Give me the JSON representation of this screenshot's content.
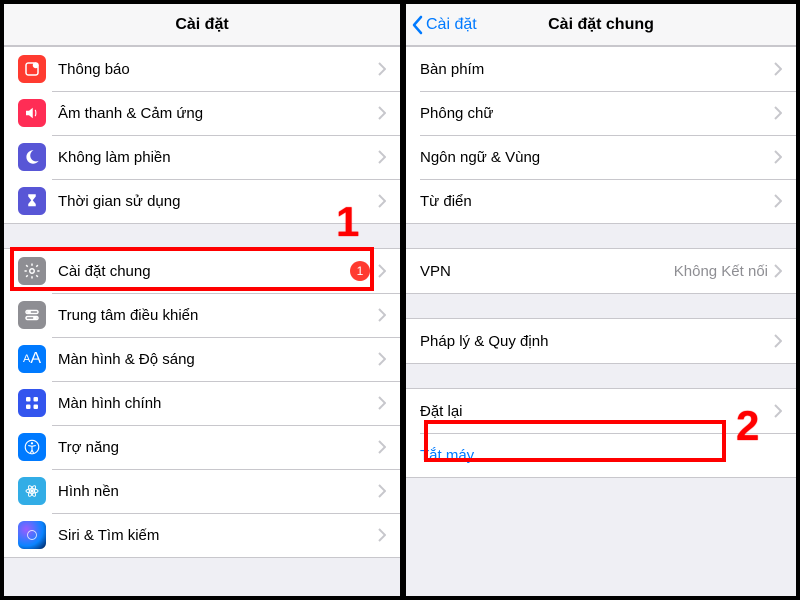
{
  "left": {
    "title": "Cài đặt",
    "rows": [
      {
        "key": "notifications",
        "label": "Thông báo",
        "icon": "notif",
        "bg": "bg-red"
      },
      {
        "key": "sounds",
        "label": "Âm thanh & Cảm ứng",
        "icon": "sound",
        "bg": "bg-pink"
      },
      {
        "key": "dnd",
        "label": "Không làm phiền",
        "icon": "moon",
        "bg": "bg-purple"
      },
      {
        "key": "screentime",
        "label": "Thời gian sử dụng",
        "icon": "hourglass",
        "bg": "bg-indigo"
      }
    ],
    "rows2": [
      {
        "key": "general",
        "label": "Cài đặt chung",
        "icon": "gear",
        "bg": "bg-gray",
        "badge": "1"
      },
      {
        "key": "controlcenter",
        "label": "Trung tâm điều khiển",
        "icon": "switches",
        "bg": "bg-gray"
      },
      {
        "key": "display",
        "label": "Màn hình & Độ sáng",
        "icon": "aa",
        "bg": "bg-blue"
      },
      {
        "key": "homescreen",
        "label": "Màn hình chính",
        "icon": "grid",
        "bg": "bg-home"
      },
      {
        "key": "accessibility",
        "label": "Trợ năng",
        "icon": "person",
        "bg": "bg-blue"
      },
      {
        "key": "wallpaper",
        "label": "Hình nền",
        "icon": "flower",
        "bg": "bg-cyan"
      },
      {
        "key": "siri",
        "label": "Siri & Tìm kiếm",
        "icon": "siri",
        "bg": "bg-siri"
      }
    ]
  },
  "right": {
    "back": "Cài đặt",
    "title": "Cài đặt chung",
    "g1": [
      {
        "key": "keyboard",
        "label": "Bàn phím"
      },
      {
        "key": "fonts",
        "label": "Phông chữ"
      },
      {
        "key": "language",
        "label": "Ngôn ngữ & Vùng"
      },
      {
        "key": "dictionary",
        "label": "Từ điển"
      }
    ],
    "g2": [
      {
        "key": "vpn",
        "label": "VPN",
        "detail": "Không Kết nối"
      }
    ],
    "g3": [
      {
        "key": "legal",
        "label": "Pháp lý & Quy định"
      }
    ],
    "g4": [
      {
        "key": "reset",
        "label": "Đặt lại"
      },
      {
        "key": "shutdown",
        "label": "Tắt máy",
        "link": true,
        "nochev": true
      }
    ]
  },
  "annot": {
    "one": "1",
    "two": "2"
  }
}
